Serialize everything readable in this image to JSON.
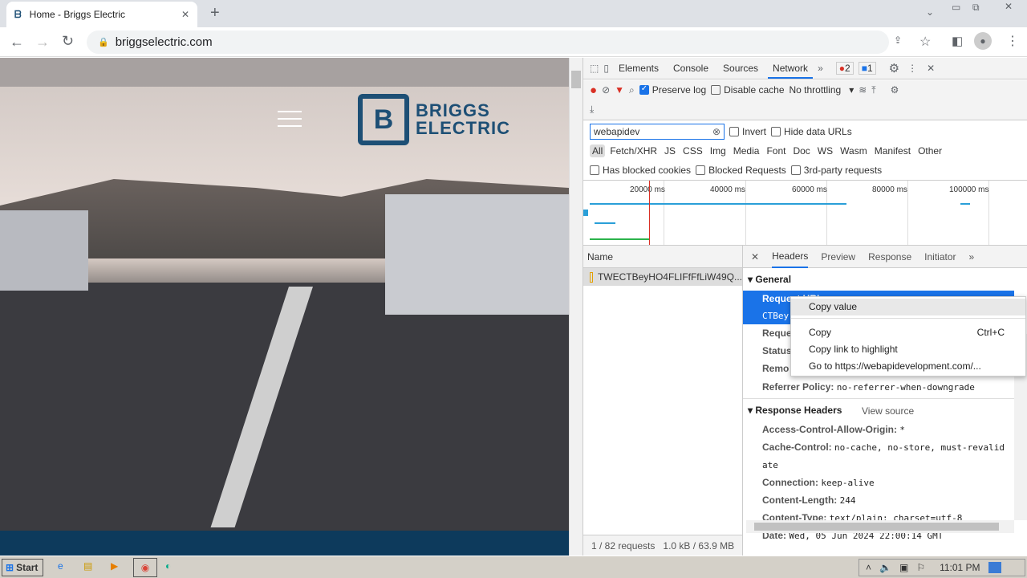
{
  "browser": {
    "tab_title": "Home - Briggs Electric",
    "url": "briggselectric.com"
  },
  "site": {
    "logo_line1": "BRIGGS",
    "logo_line2": "ELECTRIC"
  },
  "devtools": {
    "tabs": [
      "Elements",
      "Console",
      "Sources",
      "Network"
    ],
    "errors": "2",
    "messages": "1",
    "preserve_log": "Preserve log",
    "disable_cache": "Disable cache",
    "throttling": "No throttling",
    "filter_value": "webapidev",
    "invert": "Invert",
    "hide_data_urls": "Hide data URLs",
    "types": [
      "All",
      "Fetch/XHR",
      "JS",
      "CSS",
      "Img",
      "Media",
      "Font",
      "Doc",
      "WS",
      "Wasm",
      "Manifest",
      "Other"
    ],
    "has_blocked_cookies": "Has blocked cookies",
    "blocked_requests": "Blocked Requests",
    "third_party": "3rd-party requests",
    "timeline_ticks": [
      "20000 ms",
      "40000 ms",
      "60000 ms",
      "80000 ms",
      "100000 ms"
    ],
    "name_header": "Name",
    "request_name": "TWECTBeyHO4FLIFfFfLiW49Q...",
    "status_requests": "1 / 82 requests",
    "status_size": "1.0 kB / 63.9 MB",
    "detail_tabs": [
      "Headers",
      "Preview",
      "Response",
      "Initiator"
    ],
    "general": "General",
    "general_rows": {
      "request_url": "Request URL",
      "url_frag": "CTBey",
      "request_method": "Reque",
      "status": "Status",
      "remote": "Remo",
      "referrer_key": "Referrer Policy:",
      "referrer_val": "no-referrer-when-downgrade"
    },
    "response_headers": "Response Headers",
    "view_source": "View source",
    "response_rows": [
      {
        "k": "Access-Control-Allow-Origin:",
        "v": "*"
      },
      {
        "k": "Cache-Control:",
        "v": "no-cache, no-store, must-revalid"
      },
      {
        "k": "",
        "v": "ate"
      },
      {
        "k": "Connection:",
        "v": "keep-alive"
      },
      {
        "k": "Content-Length:",
        "v": "244"
      },
      {
        "k": "Content-Type:",
        "v": "text/plain; charset=utf-8"
      },
      {
        "k": "Date:",
        "v": "Wed, 05 Jun 2024 22:00:14 GMT"
      }
    ],
    "context_menu": {
      "copy_value": "Copy value",
      "copy": "Copy",
      "copy_shortcut": "Ctrl+C",
      "copy_link": "Copy link to highlight",
      "goto": "Go to https://webapidevelopment.com/..."
    }
  },
  "taskbar": {
    "start": "Start",
    "clock": "11:01 PM"
  }
}
